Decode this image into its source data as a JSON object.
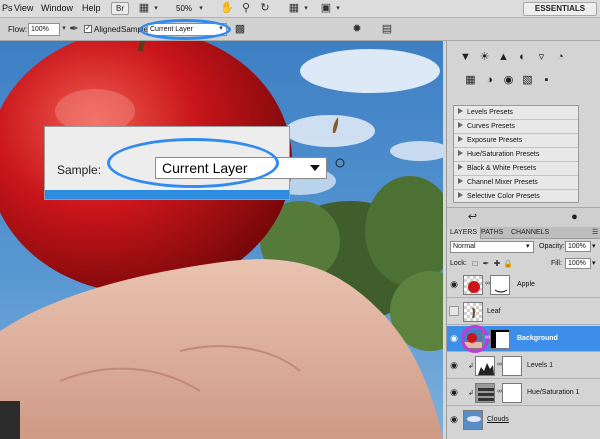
{
  "menu": {
    "items": [
      "Ps",
      "View",
      "Window",
      "Help"
    ],
    "bridge_badge": "Br",
    "zoom": "50%",
    "workspace": "ESSENTIALS",
    "icons": [
      "mini-bridge-icon",
      "arrange-icon",
      "hand-tool-icon",
      "zoom-tool-icon",
      "rotate-view-icon",
      "extras-icon",
      "screen-mode-icon"
    ]
  },
  "options": {
    "flow_label": "Flow:",
    "flow_value": "100%",
    "aligned_label": "Aligned",
    "sample_label": "Sample:",
    "sample_value": "Current Layer",
    "icons": [
      "airbrush-icon",
      "ignore-adjustment-icon",
      "clone-source-icon",
      "pressure-size-icon"
    ]
  },
  "callout": {
    "sample_label": "Sample:",
    "sample_value": "Current Layer"
  },
  "adjustments": {
    "presets": [
      "Levels Presets",
      "Curves Presets",
      "Exposure Presets",
      "Hue/Saturation Presets",
      "Black & White Presets",
      "Channel Mixer Presets",
      "Selective Color Presets"
    ],
    "row1_icons": [
      "curves-icon",
      "brightness-icon",
      "levels-icon",
      "exposure-icon",
      "vibrance-icon",
      "balance-icon"
    ],
    "row2_icons": [
      "color-balance-icon",
      "black-white-icon",
      "photo-filter-icon",
      "gradient-map-icon",
      "invert-icon"
    ]
  },
  "layers_panel": {
    "tabs": [
      "LAYERS",
      "PATHS",
      "CHANNELS"
    ],
    "blend_mode": "Normal",
    "opacity_label": "Opacity:",
    "opacity_value": "100%",
    "lock_label": "Lock:",
    "fill_label": "Fill:",
    "fill_value": "100%",
    "layers": [
      {
        "name": "Apple",
        "visible": true,
        "selected": false
      },
      {
        "name": "Leaf",
        "visible": false,
        "selected": false
      },
      {
        "name": "Background",
        "visible": true,
        "selected": true
      },
      {
        "name": "Levels 1",
        "visible": true,
        "selected": false
      },
      {
        "name": "Hue/Saturation 1",
        "visible": true,
        "selected": false
      },
      {
        "name": "Clouds",
        "visible": true,
        "selected": false
      }
    ]
  },
  "colors": {
    "selection_blue": "#3c8ee8",
    "highlight_oval": "#2f8bf0",
    "highlight_ring": "#c23bd9"
  }
}
